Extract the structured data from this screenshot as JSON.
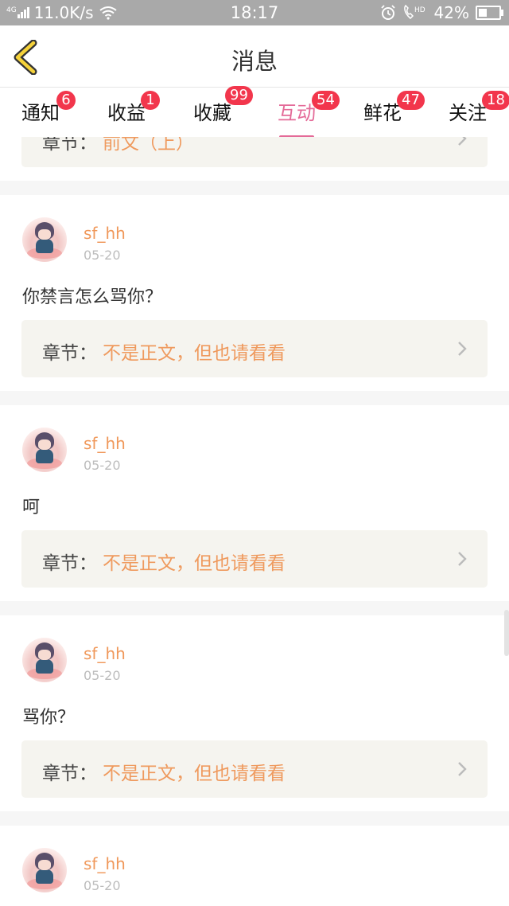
{
  "status_bar": {
    "network": "4G",
    "speed": "11.0K/s",
    "time": "18:17",
    "battery": "42%",
    "battery_level": 0.42
  },
  "header": {
    "title": "消息"
  },
  "tabs": [
    {
      "label": "通知",
      "badge": "6"
    },
    {
      "label": "收益",
      "badge": "1"
    },
    {
      "label": "收藏",
      "badge": "99"
    },
    {
      "label": "互动",
      "badge": "54",
      "active": true
    },
    {
      "label": "鲜花",
      "badge": "47"
    },
    {
      "label": "关注",
      "badge": "18"
    }
  ],
  "top_card": {
    "chapter_label": "章节：",
    "chapter_name": "前文（上）"
  },
  "cards": [
    {
      "username": "sf_hh",
      "date": "05-20",
      "comment": "你禁言怎么骂你？",
      "chapter_label": "章节：",
      "chapter_name": "不是正文，但也请看看"
    },
    {
      "username": "sf_hh",
      "date": "05-20",
      "comment": "呵",
      "chapter_label": "章节：",
      "chapter_name": "不是正文，但也请看看"
    },
    {
      "username": "sf_hh",
      "date": "05-20",
      "comment": "骂你？",
      "chapter_label": "章节：",
      "chapter_name": "不是正文，但也请看看"
    },
    {
      "username": "sf_hh",
      "date": "05-20"
    }
  ],
  "colors": {
    "accent_pink": "#e46a98",
    "badge_red": "#f2364c",
    "username_orange": "#f0985a",
    "chapter_orange": "#ef9a5e",
    "status_bar_gray": "#a9a9a9"
  }
}
